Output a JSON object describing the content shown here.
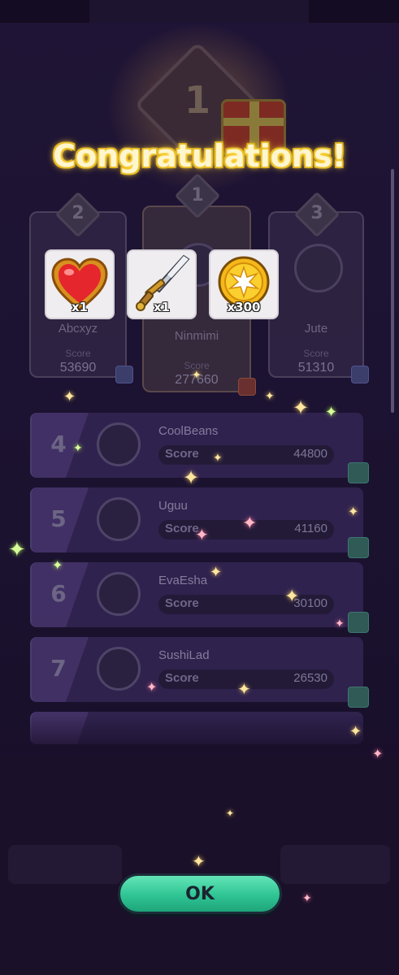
{
  "title": "Congratulations!",
  "top_rank_badge": "1",
  "podium": [
    {
      "rank": "2",
      "name": "Abcxyz",
      "score_label": "Score",
      "score": "53690"
    },
    {
      "rank": "1",
      "name": "Ninmimi",
      "score_label": "Score",
      "score": "277660"
    },
    {
      "rank": "3",
      "name": "Jute",
      "score_label": "Score",
      "score": "51310"
    }
  ],
  "rewards": [
    {
      "icon": "heart-icon",
      "qty": "x1"
    },
    {
      "icon": "sword-icon",
      "qty": "x1"
    },
    {
      "icon": "gold-coin-icon",
      "qty": "x300"
    }
  ],
  "rows": [
    {
      "rank": "4",
      "name": "CoolBeans",
      "score_label": "Score",
      "score": "44800"
    },
    {
      "rank": "5",
      "name": "Uguu",
      "score_label": "Score",
      "score": "41160"
    },
    {
      "rank": "6",
      "name": "EvaEsha",
      "score_label": "Score",
      "score": "30100"
    },
    {
      "rank": "7",
      "name": "SushiLad",
      "score_label": "Score",
      "score": "26530"
    }
  ],
  "ok_label": "OK",
  "colors": {
    "button": "#2fc493",
    "title_glow": "#ffd23a",
    "background": "#1a0f2b"
  }
}
